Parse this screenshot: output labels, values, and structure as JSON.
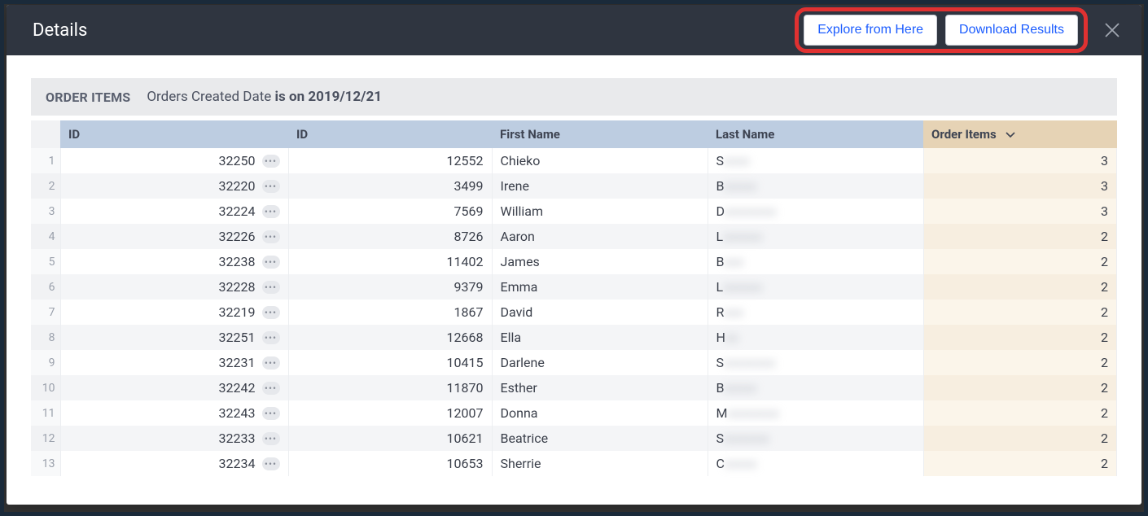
{
  "header": {
    "title": "Details",
    "explore_button": "Explore from Here",
    "download_button": "Download Results"
  },
  "filter": {
    "section": "ORDER ITEMS",
    "field": "Orders Created Date",
    "predicate": "is on 2019/12/21"
  },
  "columns": {
    "id1": "ID",
    "id2": "ID",
    "first_name": "First Name",
    "last_name": "Last Name",
    "order_items": "Order Items"
  },
  "rows": [
    {
      "n": "1",
      "id1": "32250",
      "id2": "12552",
      "first": "Chieko",
      "last_initial": "S",
      "last_rest": "xxxx",
      "items": "3"
    },
    {
      "n": "2",
      "id1": "32220",
      "id2": "3499",
      "first": "Irene",
      "last_initial": "B",
      "last_rest": "xxxxx",
      "items": "3"
    },
    {
      "n": "3",
      "id1": "32224",
      "id2": "7569",
      "first": "William",
      "last_initial": "D",
      "last_rest": "xxxxxxxx",
      "items": "3"
    },
    {
      "n": "4",
      "id1": "32226",
      "id2": "8726",
      "first": "Aaron",
      "last_initial": "L",
      "last_rest": "xxxxxx",
      "items": "2"
    },
    {
      "n": "5",
      "id1": "32238",
      "id2": "11402",
      "first": "James",
      "last_initial": "B",
      "last_rest": "xxx",
      "items": "2"
    },
    {
      "n": "6",
      "id1": "32228",
      "id2": "9379",
      "first": "Emma",
      "last_initial": "L",
      "last_rest": "xxxxxx",
      "items": "2"
    },
    {
      "n": "7",
      "id1": "32219",
      "id2": "1867",
      "first": "David",
      "last_initial": "R",
      "last_rest": "xxx",
      "items": "2"
    },
    {
      "n": "8",
      "id1": "32251",
      "id2": "12668",
      "first": "Ella",
      "last_initial": "H",
      "last_rest": "xx",
      "items": "2"
    },
    {
      "n": "9",
      "id1": "32231",
      "id2": "10415",
      "first": "Darlene",
      "last_initial": "S",
      "last_rest": "xxxxxxxx",
      "items": "2"
    },
    {
      "n": "10",
      "id1": "32242",
      "id2": "11870",
      "first": "Esther",
      "last_initial": "B",
      "last_rest": "xxxxx",
      "items": "2"
    },
    {
      "n": "11",
      "id1": "32243",
      "id2": "12007",
      "first": "Donna",
      "last_initial": "M",
      "last_rest": "xxxxxxxx",
      "items": "2"
    },
    {
      "n": "12",
      "id1": "32233",
      "id2": "10621",
      "first": "Beatrice",
      "last_initial": "S",
      "last_rest": "xxxxxxx",
      "items": "2"
    },
    {
      "n": "13",
      "id1": "32234",
      "id2": "10653",
      "first": "Sherrie",
      "last_initial": "C",
      "last_rest": "xxxxx",
      "items": "2"
    }
  ]
}
